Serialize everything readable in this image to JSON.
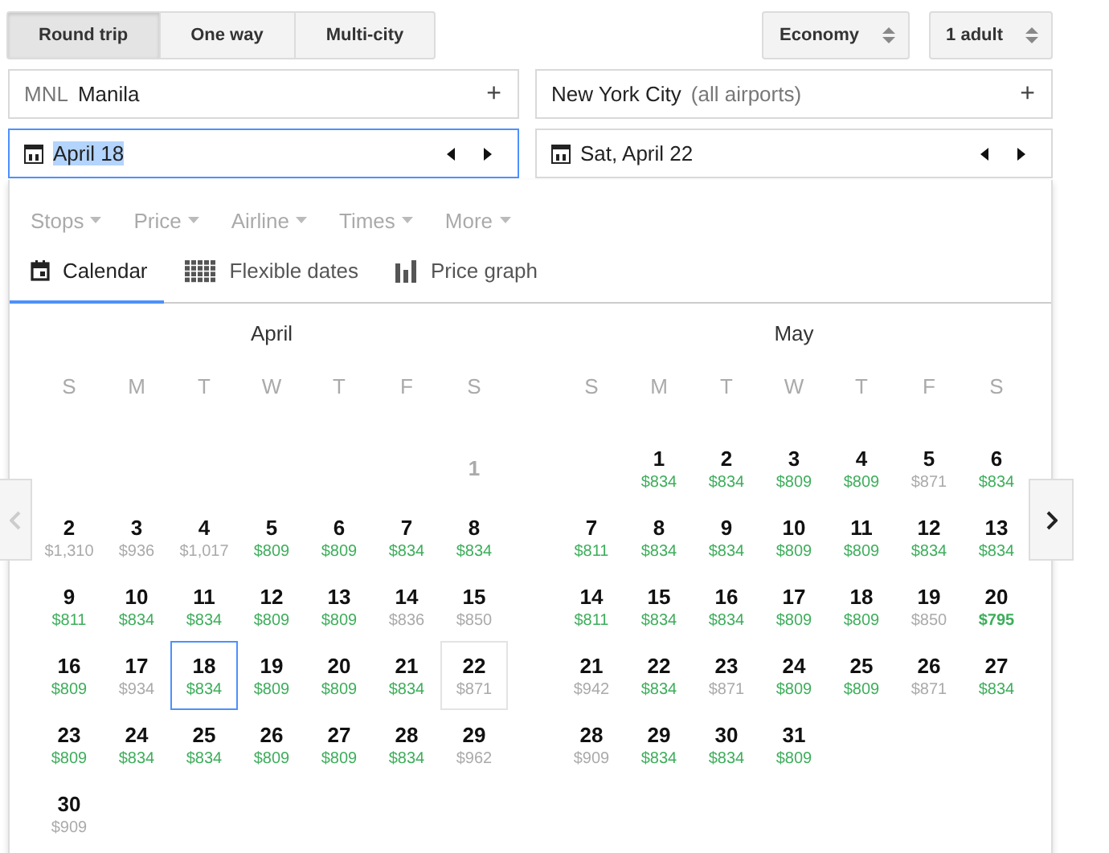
{
  "trip_types": [
    {
      "label": "Round trip",
      "selected": true
    },
    {
      "label": "One way",
      "selected": false
    },
    {
      "label": "Multi-city",
      "selected": false
    }
  ],
  "cabin": {
    "value": "Economy"
  },
  "passengers": {
    "value": "1 adult"
  },
  "origin": {
    "code": "MNL",
    "city": "Manila",
    "add": "+"
  },
  "destination": {
    "city": "New York City",
    "note": "(all airports)",
    "add": "+"
  },
  "depart_date": {
    "value": "April 18",
    "focused": true
  },
  "return_date": {
    "value": "Sat, April 22",
    "focused": false
  },
  "filters": [
    {
      "label": "Stops"
    },
    {
      "label": "Price"
    },
    {
      "label": "Airline"
    },
    {
      "label": "Times"
    },
    {
      "label": "More"
    }
  ],
  "views": [
    {
      "label": "Calendar",
      "kind": "calendar",
      "selected": true
    },
    {
      "label": "Flexible dates",
      "kind": "grid",
      "selected": false
    },
    {
      "label": "Price graph",
      "kind": "bars",
      "selected": false
    }
  ],
  "months": [
    {
      "name": "April",
      "weekdays": [
        "S",
        "M",
        "T",
        "W",
        "T",
        "F",
        "S"
      ],
      "weeks": [
        [
          {
            "kind": "blank"
          },
          {
            "kind": "blank"
          },
          {
            "kind": "blank"
          },
          {
            "kind": "blank"
          },
          {
            "kind": "blank"
          },
          {
            "kind": "blank"
          },
          {
            "kind": "day",
            "day": "1",
            "selected": false,
            "return": false
          }
        ],
        [
          {
            "kind": "day",
            "day": "2",
            "price": "$1,310",
            "cheap": false,
            "lowest": false,
            "selected": false,
            "return": false
          },
          {
            "kind": "day",
            "day": "3",
            "price": "$936",
            "cheap": false,
            "lowest": false,
            "selected": false,
            "return": false
          },
          {
            "kind": "day",
            "day": "4",
            "price": "$1,017",
            "cheap": false,
            "lowest": false,
            "selected": false,
            "return": false
          },
          {
            "kind": "day",
            "day": "5",
            "price": "$809",
            "cheap": true,
            "lowest": false,
            "selected": false,
            "return": false
          },
          {
            "kind": "day",
            "day": "6",
            "price": "$809",
            "cheap": true,
            "lowest": false,
            "selected": false,
            "return": false
          },
          {
            "kind": "day",
            "day": "7",
            "price": "$834",
            "cheap": true,
            "lowest": false,
            "selected": false,
            "return": false
          },
          {
            "kind": "day",
            "day": "8",
            "price": "$834",
            "cheap": true,
            "lowest": false,
            "selected": false,
            "return": false
          }
        ],
        [
          {
            "kind": "day",
            "day": "9",
            "price": "$811",
            "cheap": true,
            "lowest": false,
            "selected": false,
            "return": false
          },
          {
            "kind": "day",
            "day": "10",
            "price": "$834",
            "cheap": true,
            "lowest": false,
            "selected": false,
            "return": false
          },
          {
            "kind": "day",
            "day": "11",
            "price": "$834",
            "cheap": true,
            "lowest": false,
            "selected": false,
            "return": false
          },
          {
            "kind": "day",
            "day": "12",
            "price": "$809",
            "cheap": true,
            "lowest": false,
            "selected": false,
            "return": false
          },
          {
            "kind": "day",
            "day": "13",
            "price": "$809",
            "cheap": true,
            "lowest": false,
            "selected": false,
            "return": false
          },
          {
            "kind": "day",
            "day": "14",
            "price": "$836",
            "cheap": false,
            "lowest": false,
            "selected": false,
            "return": false
          },
          {
            "kind": "day",
            "day": "15",
            "price": "$850",
            "cheap": false,
            "lowest": false,
            "selected": false,
            "return": false
          }
        ],
        [
          {
            "kind": "day",
            "day": "16",
            "price": "$809",
            "cheap": true,
            "lowest": false,
            "selected": false,
            "return": false
          },
          {
            "kind": "day",
            "day": "17",
            "price": "$934",
            "cheap": false,
            "lowest": false,
            "selected": false,
            "return": false
          },
          {
            "kind": "day",
            "day": "18",
            "price": "$834",
            "cheap": true,
            "lowest": false,
            "selected": true,
            "return": false
          },
          {
            "kind": "day",
            "day": "19",
            "price": "$809",
            "cheap": true,
            "lowest": false,
            "selected": false,
            "return": false
          },
          {
            "kind": "day",
            "day": "20",
            "price": "$809",
            "cheap": true,
            "lowest": false,
            "selected": false,
            "return": false
          },
          {
            "kind": "day",
            "day": "21",
            "price": "$834",
            "cheap": true,
            "lowest": false,
            "selected": false,
            "return": false
          },
          {
            "kind": "day",
            "day": "22",
            "price": "$871",
            "cheap": false,
            "lowest": false,
            "selected": false,
            "return": true
          }
        ],
        [
          {
            "kind": "day",
            "day": "23",
            "price": "$809",
            "cheap": true,
            "lowest": false,
            "selected": false,
            "return": false
          },
          {
            "kind": "day",
            "day": "24",
            "price": "$834",
            "cheap": true,
            "lowest": false,
            "selected": false,
            "return": false
          },
          {
            "kind": "day",
            "day": "25",
            "price": "$834",
            "cheap": true,
            "lowest": false,
            "selected": false,
            "return": false
          },
          {
            "kind": "day",
            "day": "26",
            "price": "$809",
            "cheap": true,
            "lowest": false,
            "selected": false,
            "return": false
          },
          {
            "kind": "day",
            "day": "27",
            "price": "$809",
            "cheap": true,
            "lowest": false,
            "selected": false,
            "return": false
          },
          {
            "kind": "day",
            "day": "28",
            "price": "$834",
            "cheap": true,
            "lowest": false,
            "selected": false,
            "return": false
          },
          {
            "kind": "day",
            "day": "29",
            "price": "$962",
            "cheap": false,
            "lowest": false,
            "selected": false,
            "return": false
          }
        ],
        [
          {
            "kind": "day",
            "day": "30",
            "price": "$909",
            "cheap": false,
            "lowest": false,
            "selected": false,
            "return": false
          }
        ]
      ]
    },
    {
      "name": "May",
      "weekdays": [
        "S",
        "M",
        "T",
        "W",
        "T",
        "F",
        "S"
      ],
      "weeks": [
        [
          {
            "kind": "blank"
          },
          {
            "kind": "day",
            "day": "1",
            "price": "$834",
            "cheap": true,
            "lowest": false,
            "selected": false,
            "return": false
          },
          {
            "kind": "day",
            "day": "2",
            "price": "$834",
            "cheap": true,
            "lowest": false,
            "selected": false,
            "return": false
          },
          {
            "kind": "day",
            "day": "3",
            "price": "$809",
            "cheap": true,
            "lowest": false,
            "selected": false,
            "return": false
          },
          {
            "kind": "day",
            "day": "4",
            "price": "$809",
            "cheap": true,
            "lowest": false,
            "selected": false,
            "return": false
          },
          {
            "kind": "day",
            "day": "5",
            "price": "$871",
            "cheap": false,
            "lowest": false,
            "selected": false,
            "return": false
          },
          {
            "kind": "day",
            "day": "6",
            "price": "$834",
            "cheap": true,
            "lowest": false,
            "selected": false,
            "return": false
          }
        ],
        [
          {
            "kind": "day",
            "day": "7",
            "price": "$811",
            "cheap": true,
            "lowest": false,
            "selected": false,
            "return": false
          },
          {
            "kind": "day",
            "day": "8",
            "price": "$834",
            "cheap": true,
            "lowest": false,
            "selected": false,
            "return": false
          },
          {
            "kind": "day",
            "day": "9",
            "price": "$834",
            "cheap": true,
            "lowest": false,
            "selected": false,
            "return": false
          },
          {
            "kind": "day",
            "day": "10",
            "price": "$809",
            "cheap": true,
            "lowest": false,
            "selected": false,
            "return": false
          },
          {
            "kind": "day",
            "day": "11",
            "price": "$809",
            "cheap": true,
            "lowest": false,
            "selected": false,
            "return": false
          },
          {
            "kind": "day",
            "day": "12",
            "price": "$834",
            "cheap": true,
            "lowest": false,
            "selected": false,
            "return": false
          },
          {
            "kind": "day",
            "day": "13",
            "price": "$834",
            "cheap": true,
            "lowest": false,
            "selected": false,
            "return": false
          }
        ],
        [
          {
            "kind": "day",
            "day": "14",
            "price": "$811",
            "cheap": true,
            "lowest": false,
            "selected": false,
            "return": false
          },
          {
            "kind": "day",
            "day": "15",
            "price": "$834",
            "cheap": true,
            "lowest": false,
            "selected": false,
            "return": false
          },
          {
            "kind": "day",
            "day": "16",
            "price": "$834",
            "cheap": true,
            "lowest": false,
            "selected": false,
            "return": false
          },
          {
            "kind": "day",
            "day": "17",
            "price": "$809",
            "cheap": true,
            "lowest": false,
            "selected": false,
            "return": false
          },
          {
            "kind": "day",
            "day": "18",
            "price": "$809",
            "cheap": true,
            "lowest": false,
            "selected": false,
            "return": false
          },
          {
            "kind": "day",
            "day": "19",
            "price": "$850",
            "cheap": false,
            "lowest": false,
            "selected": false,
            "return": false
          },
          {
            "kind": "day",
            "day": "20",
            "price": "$795",
            "cheap": true,
            "lowest": true,
            "selected": false,
            "return": false
          }
        ],
        [
          {
            "kind": "day",
            "day": "21",
            "price": "$942",
            "cheap": false,
            "lowest": false,
            "selected": false,
            "return": false
          },
          {
            "kind": "day",
            "day": "22",
            "price": "$834",
            "cheap": true,
            "lowest": false,
            "selected": false,
            "return": false
          },
          {
            "kind": "day",
            "day": "23",
            "price": "$871",
            "cheap": false,
            "lowest": false,
            "selected": false,
            "return": false
          },
          {
            "kind": "day",
            "day": "24",
            "price": "$809",
            "cheap": true,
            "lowest": false,
            "selected": false,
            "return": false
          },
          {
            "kind": "day",
            "day": "25",
            "price": "$809",
            "cheap": true,
            "lowest": false,
            "selected": false,
            "return": false
          },
          {
            "kind": "day",
            "day": "26",
            "price": "$871",
            "cheap": false,
            "lowest": false,
            "selected": false,
            "return": false
          },
          {
            "kind": "day",
            "day": "27",
            "price": "$834",
            "cheap": true,
            "lowest": false,
            "selected": false,
            "return": false
          }
        ],
        [
          {
            "kind": "day",
            "day": "28",
            "price": "$909",
            "cheap": false,
            "lowest": false,
            "selected": false,
            "return": false
          },
          {
            "kind": "day",
            "day": "29",
            "price": "$834",
            "cheap": true,
            "lowest": false,
            "selected": false,
            "return": false
          },
          {
            "kind": "day",
            "day": "30",
            "price": "$834",
            "cheap": true,
            "lowest": false,
            "selected": false,
            "return": false
          },
          {
            "kind": "day",
            "day": "31",
            "price": "$809",
            "cheap": true,
            "lowest": false,
            "selected": false,
            "return": false
          }
        ]
      ]
    }
  ]
}
